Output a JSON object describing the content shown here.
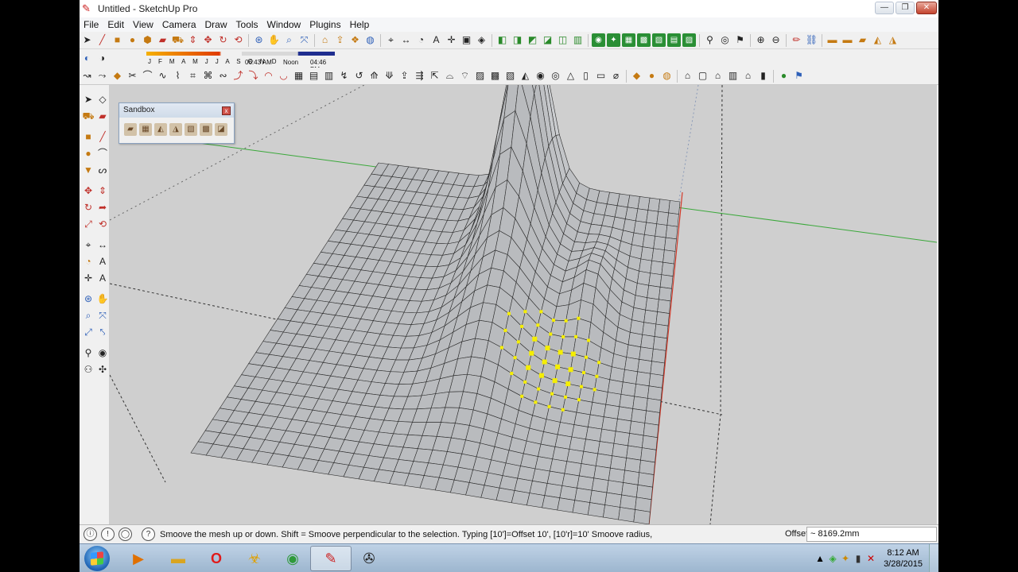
{
  "window": {
    "title": "Untitled - SketchUp Pro",
    "minimize": "—",
    "maximize": "❐",
    "close": "✕"
  },
  "menu": [
    "File",
    "Edit",
    "View",
    "Camera",
    "Draw",
    "Tools",
    "Window",
    "Plugins",
    "Help"
  ],
  "shadow_settings": {
    "months": "J F M A M J J A S O N D",
    "time_start": "06:43 AM",
    "time_noon": "Noon",
    "time_end": "04:46 PM"
  },
  "sandbox_palette": {
    "title": "Sandbox",
    "close": "x",
    "tools": [
      "from-contours",
      "from-scratch",
      "smoove",
      "stamp",
      "drape",
      "add-detail",
      "flip-edge"
    ]
  },
  "statusbar": {
    "instruction": "Smoove the mesh up or down.  Shift = Smoove perpendicular to the selection.  Typing [10']=Offset 10', [10'r]=10' Smoove radius,",
    "vcb_label": "Offset",
    "vcb_value": "~ 8169.2mm"
  },
  "taskbar": {
    "time": "8:12 AM",
    "date": "3/28/2015"
  },
  "colors": {
    "mesh_face": "#c9cbce",
    "mesh_edge": "#2b2b2b",
    "selection": "#f5ee00",
    "axis_green": "#3aa83a",
    "axis_red": "#d23a2a",
    "sky": "#cfcfcf"
  }
}
